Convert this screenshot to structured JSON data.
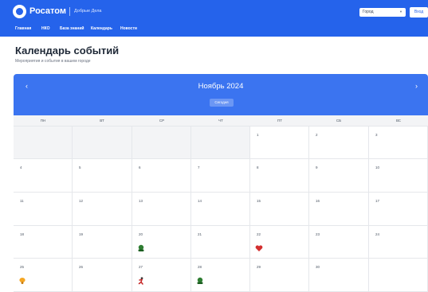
{
  "header": {
    "brand": "Росатом",
    "tagline": "Добрые Дела",
    "city_select": "Город",
    "login_button": "Вход"
  },
  "nav": {
    "items": [
      "Главная",
      "НКО",
      "База знаний",
      "Календарь",
      "Новости"
    ]
  },
  "page": {
    "title": "Календарь событий",
    "subtitle": "Мероприятия и события в вашем городе"
  },
  "calendar": {
    "month_label": "Ноябрь 2024",
    "today_button": "Сегодня",
    "weekdays": [
      "ПН",
      "ВТ",
      "СР",
      "ЧТ",
      "ПТ",
      "СБ",
      "ВС"
    ],
    "weeks": [
      [
        null,
        null,
        null,
        null,
        "1",
        "2",
        "3"
      ],
      [
        "4",
        "5",
        "6",
        "7",
        "8",
        "9",
        "10"
      ],
      [
        "11",
        "12",
        "13",
        "14",
        "15",
        "16",
        "17"
      ],
      [
        "18",
        "19",
        "20",
        "21",
        "22",
        "23",
        "24"
      ],
      [
        "25",
        "26",
        "27",
        "28",
        "29",
        "30",
        null
      ]
    ],
    "events": [
      {
        "week": 3,
        "day": 2,
        "icon": "hands-plant-icon",
        "color": "#2e7d32"
      },
      {
        "week": 3,
        "day": 4,
        "icon": "heart-icon",
        "color": "#d32f2f"
      },
      {
        "week": 4,
        "day": 0,
        "icon": "paw-icon",
        "color": "#f5a623"
      },
      {
        "week": 4,
        "day": 2,
        "icon": "runner-icon",
        "color": "#c62828"
      },
      {
        "week": 4,
        "day": 3,
        "icon": "hands-plant-icon",
        "color": "#2e7d32"
      }
    ]
  },
  "colors": {
    "header_blue": "#2563eb",
    "calendar_blue": "#3b74f0"
  }
}
